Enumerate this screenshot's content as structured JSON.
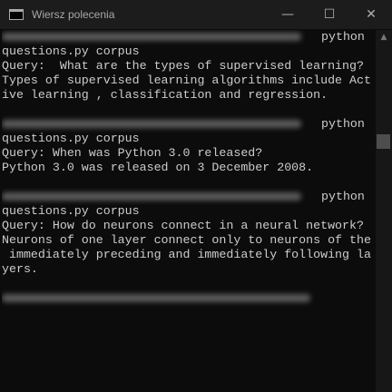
{
  "window": {
    "title": "Wiersz polecenia",
    "minimize": "—",
    "maximize": "☐",
    "close": "✕"
  },
  "console": {
    "blocks": [
      {
        "cmd_end": "python",
        "cmd": "questions.py corpus",
        "output": [
          "Query:  What are the types of supervised learning?",
          "Types of supervised learning algorithms include Act",
          "ive learning , classification and regression."
        ]
      },
      {
        "cmd_end": "python",
        "cmd": "questions.py corpus",
        "output": [
          "Query: When was Python 3.0 released?",
          "Python 3.0 was released on 3 December 2008."
        ]
      },
      {
        "cmd_end": "python",
        "cmd": "questions.py corpus",
        "output": [
          "Query: How do neurons connect in a neural network?",
          "Neurons of one layer connect only to neurons of the",
          " immediately preceding and immediately following la",
          "yers."
        ]
      }
    ]
  },
  "colors": {
    "background": "#0c0c0c",
    "text": "#cccccc"
  }
}
